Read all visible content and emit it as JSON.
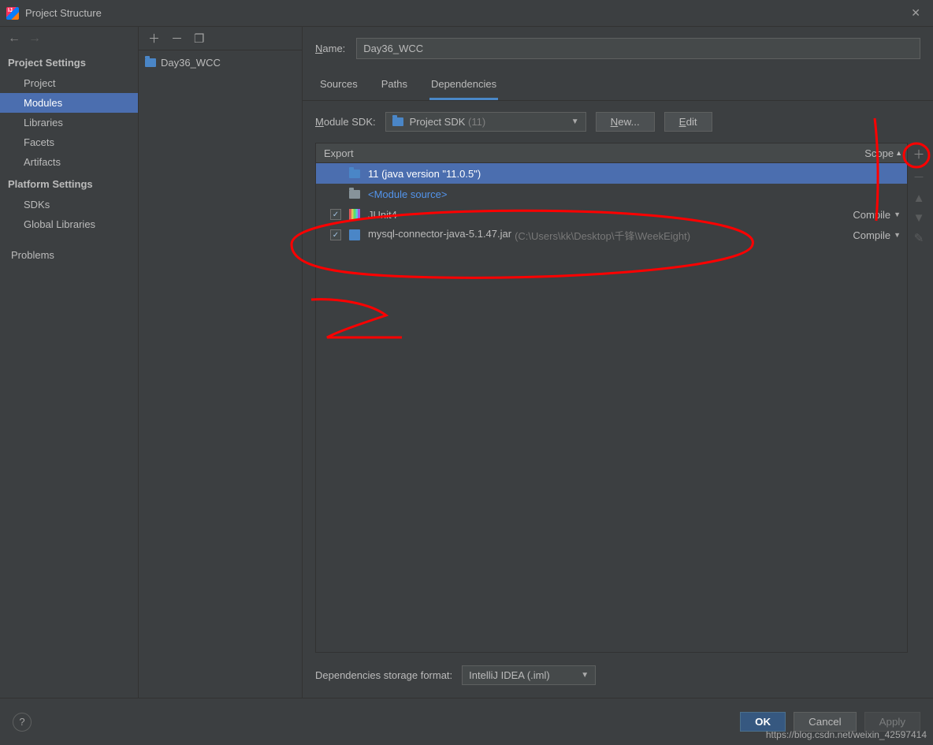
{
  "window": {
    "title": "Project Structure"
  },
  "sidebar": {
    "section1": "Project Settings",
    "items1": [
      "Project",
      "Modules",
      "Libraries",
      "Facets",
      "Artifacts"
    ],
    "section2": "Platform Settings",
    "items2": [
      "SDKs",
      "Global Libraries"
    ],
    "problems": "Problems"
  },
  "moduleTree": {
    "root": "Day36_WCC"
  },
  "content": {
    "nameLabel_pre": "N",
    "nameLabel_post": "ame:",
    "nameValue": "Day36_WCC",
    "tabs": [
      "Sources",
      "Paths",
      "Dependencies"
    ],
    "sdk": {
      "label_pre": "M",
      "label_post": "odule SDK:",
      "value": "Project SDK ",
      "suffix": "(11)",
      "new_pre": "N",
      "new_post": "ew...",
      "edit_pre": "E",
      "edit_post": "dit"
    },
    "table": {
      "exportHeader": "Export",
      "scopeHeader": "Scope",
      "rows": [
        {
          "type": "sdk",
          "name": "11 (java version \"11.0.5\")"
        },
        {
          "type": "modsrc",
          "name": "<Module source>"
        },
        {
          "type": "lib",
          "checked": true,
          "name": "JUnit4",
          "scope": "Compile"
        },
        {
          "type": "jar",
          "checked": true,
          "name": "mysql-connector-java-5.1.47.jar",
          "path": "(C:\\Users\\kk\\Desktop\\千锋\\WeekEight)",
          "scope": "Compile"
        }
      ]
    },
    "storage": {
      "label": "Dependencies storage format:",
      "value": "IntelliJ IDEA (.iml)"
    }
  },
  "footer": {
    "ok": "OK",
    "cancel": "Cancel",
    "apply": "Apply"
  },
  "watermark": "https://blog.csdn.net/weixin_42597414"
}
